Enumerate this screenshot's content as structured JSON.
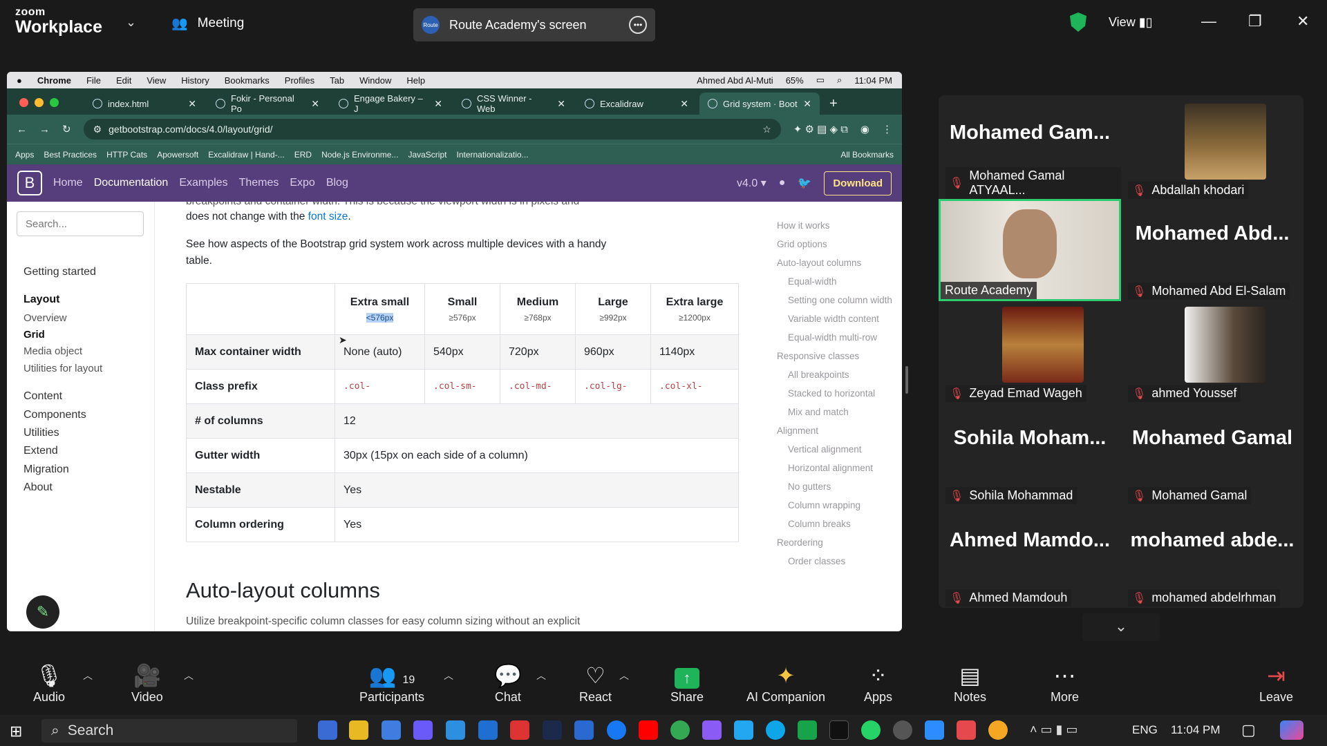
{
  "zoom": {
    "logo_top": "zoom",
    "logo_bottom": "Workplace",
    "meeting": "Meeting",
    "share_label": "Route Academy's screen",
    "share_logo": "Route",
    "view": "View"
  },
  "mac": {
    "items": [
      "Chrome",
      "File",
      "Edit",
      "View",
      "History",
      "Bookmarks",
      "Profiles",
      "Tab",
      "Window",
      "Help"
    ],
    "user": "Ahmed Abd Al-Muti",
    "battery": "65%",
    "time": "11:04 PM"
  },
  "tabs": [
    {
      "label": "index.html"
    },
    {
      "label": "Fokir - Personal Po"
    },
    {
      "label": "Engage Bakery – J"
    },
    {
      "label": "CSS Winner - Web"
    },
    {
      "label": "Excalidraw"
    },
    {
      "label": "Grid system · Boot"
    }
  ],
  "url": "getbootstrap.com/docs/4.0/layout/grid/",
  "bookmarks": [
    "Apps",
    "Best Practices",
    "HTTP Cats",
    "Apowersoft",
    "Excalidraw | Hand-...",
    "ERD",
    "Node.js Environme...",
    "JavaScript",
    "Internationalizatio...",
    "All Bookmarks"
  ],
  "bs": {
    "logo": "B",
    "nav": [
      "Home",
      "Documentation",
      "Examples",
      "Themes",
      "Expo",
      "Blog"
    ],
    "version": "v4.0",
    "download": "Download",
    "search_placeholder": "Search..."
  },
  "sidenav": {
    "getting_started": "Getting started",
    "layout": "Layout",
    "layout_items": [
      "Overview",
      "Grid",
      "Media object",
      "Utilities for layout"
    ],
    "rest": [
      "Content",
      "Components",
      "Utilities",
      "Extend",
      "Migration",
      "About"
    ]
  },
  "content": {
    "cut_top": "breakpoints and container width. This is because the viewport width is in pixels and",
    "p1a": "does not change with the ",
    "p1link": "font size",
    "p1b": ".",
    "p2": "See how aspects of the Bootstrap grid system work across multiple devices with a handy table.",
    "h2": "Auto-layout columns",
    "cut_bottom": "Utilize breakpoint-specific column classes for easy column sizing without an explicit"
  },
  "table": {
    "headers": [
      {
        "name": "Extra small",
        "sub": "<576px"
      },
      {
        "name": "Small",
        "sub": "≥576px"
      },
      {
        "name": "Medium",
        "sub": "≥768px"
      },
      {
        "name": "Large",
        "sub": "≥992px"
      },
      {
        "name": "Extra large",
        "sub": "≥1200px"
      }
    ],
    "r1": {
      "label": "Max container width",
      "cells": [
        "None (auto)",
        "540px",
        "720px",
        "960px",
        "1140px"
      ]
    },
    "r2": {
      "label": "Class prefix",
      "cells": [
        ".col-",
        ".col-sm-",
        ".col-md-",
        ".col-lg-",
        ".col-xl-"
      ]
    },
    "r3": {
      "label": "# of columns",
      "value": "12"
    },
    "r4": {
      "label": "Gutter width",
      "value": "30px (15px on each side of a column)"
    },
    "r5": {
      "label": "Nestable",
      "value": "Yes"
    },
    "r6": {
      "label": "Column ordering",
      "value": "Yes"
    }
  },
  "toc": [
    "How it works",
    "Grid options",
    "Auto-layout columns",
    "Equal-width",
    "Setting one column width",
    "Variable width content",
    "Equal-width multi-row",
    "Responsive classes",
    "All breakpoints",
    "Stacked to horizontal",
    "Mix and match",
    "Alignment",
    "Vertical alignment",
    "Horizontal alignment",
    "No gutters",
    "Column wrapping",
    "Column breaks",
    "Reordering",
    "Order classes"
  ],
  "participants": [
    {
      "big": "Mohamed  Gam...",
      "name": "Mohamed Gamal ATYAAL..."
    },
    {
      "big": "",
      "name": "Abdallah khodari"
    },
    {
      "big": "",
      "name": "Route Academy"
    },
    {
      "big": "Mohamed  Abd...",
      "name": "Mohamed Abd El-Salam"
    },
    {
      "big": "",
      "name": "Zeyad Emad Wageh"
    },
    {
      "big": "",
      "name": "ahmed Youssef"
    },
    {
      "big": "Sohila  Moham...",
      "name": "Sohila Mohammad"
    },
    {
      "big": "Mohamed Gamal",
      "name": "Mohamed Gamal"
    },
    {
      "big": "Ahmed  Mamdo...",
      "name": "Ahmed Mamdouh"
    },
    {
      "big": "mohamed  abde...",
      "name": "mohamed abdelrhman"
    }
  ],
  "toolbar": {
    "audio": "Audio",
    "video": "Video",
    "participants": "Participants",
    "count": "19",
    "chat": "Chat",
    "react": "React",
    "share": "Share",
    "ai": "AI Companion",
    "apps": "Apps",
    "notes": "Notes",
    "more": "More",
    "leave": "Leave"
  },
  "taskbar": {
    "search": "Search",
    "lang": "ENG",
    "time": "11:04 PM"
  }
}
